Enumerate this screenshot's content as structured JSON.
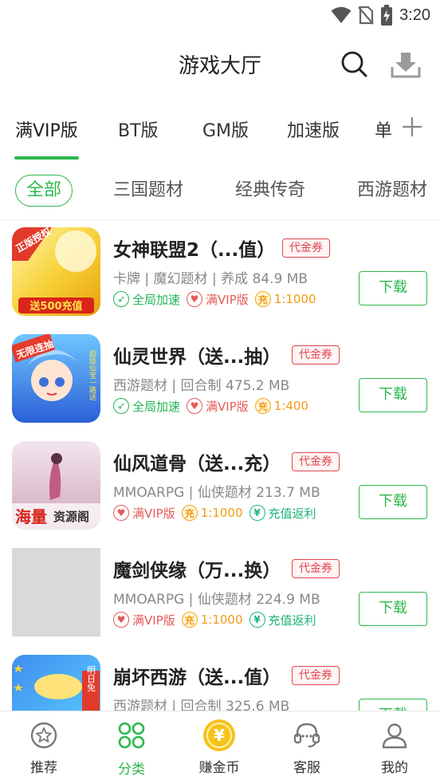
{
  "status_bar": {
    "time": "3:20"
  },
  "header": {
    "title": "游戏大厅"
  },
  "tabs": [
    {
      "label": "满VIP版"
    },
    {
      "label": "BT版"
    },
    {
      "label": "GM版"
    },
    {
      "label": "加速版"
    },
    {
      "label": "单"
    }
  ],
  "filters": [
    {
      "label": "全部"
    },
    {
      "label": "三国题材"
    },
    {
      "label": "经典传奇"
    },
    {
      "label": "西游题材"
    }
  ],
  "games": [
    {
      "name": "女神联盟2（...值）",
      "voucher": "代金券",
      "meta": "卡牌 | 魔幻题材 | 养成 84.9 MB",
      "tags": [
        {
          "label": "全局加速",
          "icon": "rocket-icon"
        },
        {
          "label": "满VIP版",
          "icon": "vip-heart-icon"
        },
        {
          "label": "1:1000",
          "icon": "ratio-coin-icon"
        }
      ],
      "button": "下载",
      "cover_text": [
        "正版授权",
        "送500充值"
      ]
    },
    {
      "name": "仙灵世界（送...抽）",
      "voucher": "代金券",
      "meta": "西游题材 | 回合制 475.2 MB",
      "tags": [
        {
          "label": "全局加速",
          "icon": "rocket-icon"
        },
        {
          "label": "满VIP版",
          "icon": "vip-heart-icon"
        },
        {
          "label": "1:400",
          "icon": "ratio-coin-icon"
        }
      ],
      "button": "下载",
      "cover_text": [
        "无限连抽",
        "超级仙宝一路送"
      ]
    },
    {
      "name": "仙风道骨（送...充）",
      "voucher": "代金券",
      "meta": "MMOARPG | 仙侠题材 213.7 MB",
      "tags": [
        {
          "label": "满VIP版",
          "icon": "vip-heart-icon"
        },
        {
          "label": "1:1000",
          "icon": "ratio-coin-icon"
        },
        {
          "label": "充值返利",
          "icon": "yuan-rebate-icon"
        }
      ],
      "button": "下载",
      "cover_text": [
        "海量",
        "资源阁"
      ]
    },
    {
      "name": "魔剑侠缘（万...换）",
      "voucher": "代金券",
      "meta": "MMOARPG | 仙侠题材 224.9 MB",
      "tags": [
        {
          "label": "满VIP版",
          "icon": "vip-heart-icon"
        },
        {
          "label": "1:1000",
          "icon": "ratio-coin-icon"
        },
        {
          "label": "充值返利",
          "icon": "yuan-rebate-icon"
        }
      ],
      "button": "下载",
      "cover_text": []
    },
    {
      "name": "崩坏西游（送...值）",
      "voucher": "代金券",
      "meta": "西游题材 | 回合制 325.6 MB",
      "tags": [],
      "button": "下载",
      "cover_text": [
        "明日免"
      ]
    }
  ],
  "bottom_nav": [
    {
      "label": "推荐",
      "icon": "star-badge-icon"
    },
    {
      "label": "分类",
      "icon": "category-grid-icon"
    },
    {
      "label": "赚金币",
      "icon": "coin-yuan-icon",
      "glyph": "¥"
    },
    {
      "label": "客服",
      "icon": "headset-icon"
    },
    {
      "label": "我的",
      "icon": "user-icon"
    }
  ],
  "colors": {
    "accent": "#2db84d",
    "voucher": "#e0474e",
    "meta_text": "#888888"
  }
}
